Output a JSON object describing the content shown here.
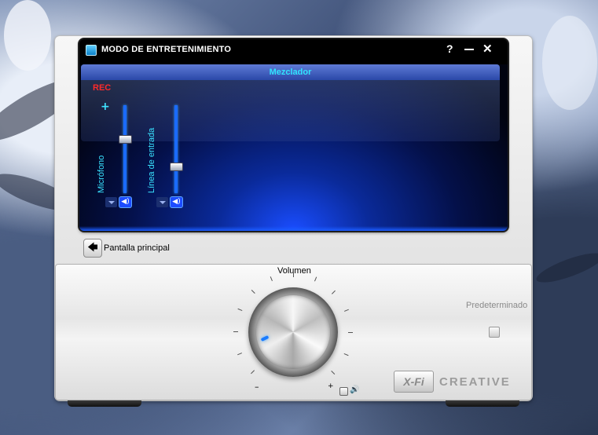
{
  "window": {
    "title": "MODO DE ENTRETENIMIENTO",
    "help_label": "?",
    "close_label": "✕"
  },
  "mixer": {
    "title": "Mezclador",
    "rec_label": "REC",
    "plus_label": "+",
    "channels": [
      {
        "label": "Micrófono",
        "level": 0.62
      },
      {
        "label": "Línea de entrada",
        "level": 0.3
      }
    ]
  },
  "nav": {
    "back_label": "Pantalla principal"
  },
  "volume": {
    "label": "Volumen",
    "minus_label": "–",
    "plus_label": "+",
    "mute_icon": "🔊"
  },
  "default_label": "Predeterminado",
  "brand": {
    "xfi": "X-Fi",
    "creative": "CREATIVE"
  },
  "icons": {
    "app": "audio-app-icon",
    "back": "arrow-left-icon",
    "speaker": "speaker-icon"
  },
  "colors": {
    "accent": "#39e2ff",
    "rec": "#ff2a2a",
    "slider": "#1a6bff"
  }
}
